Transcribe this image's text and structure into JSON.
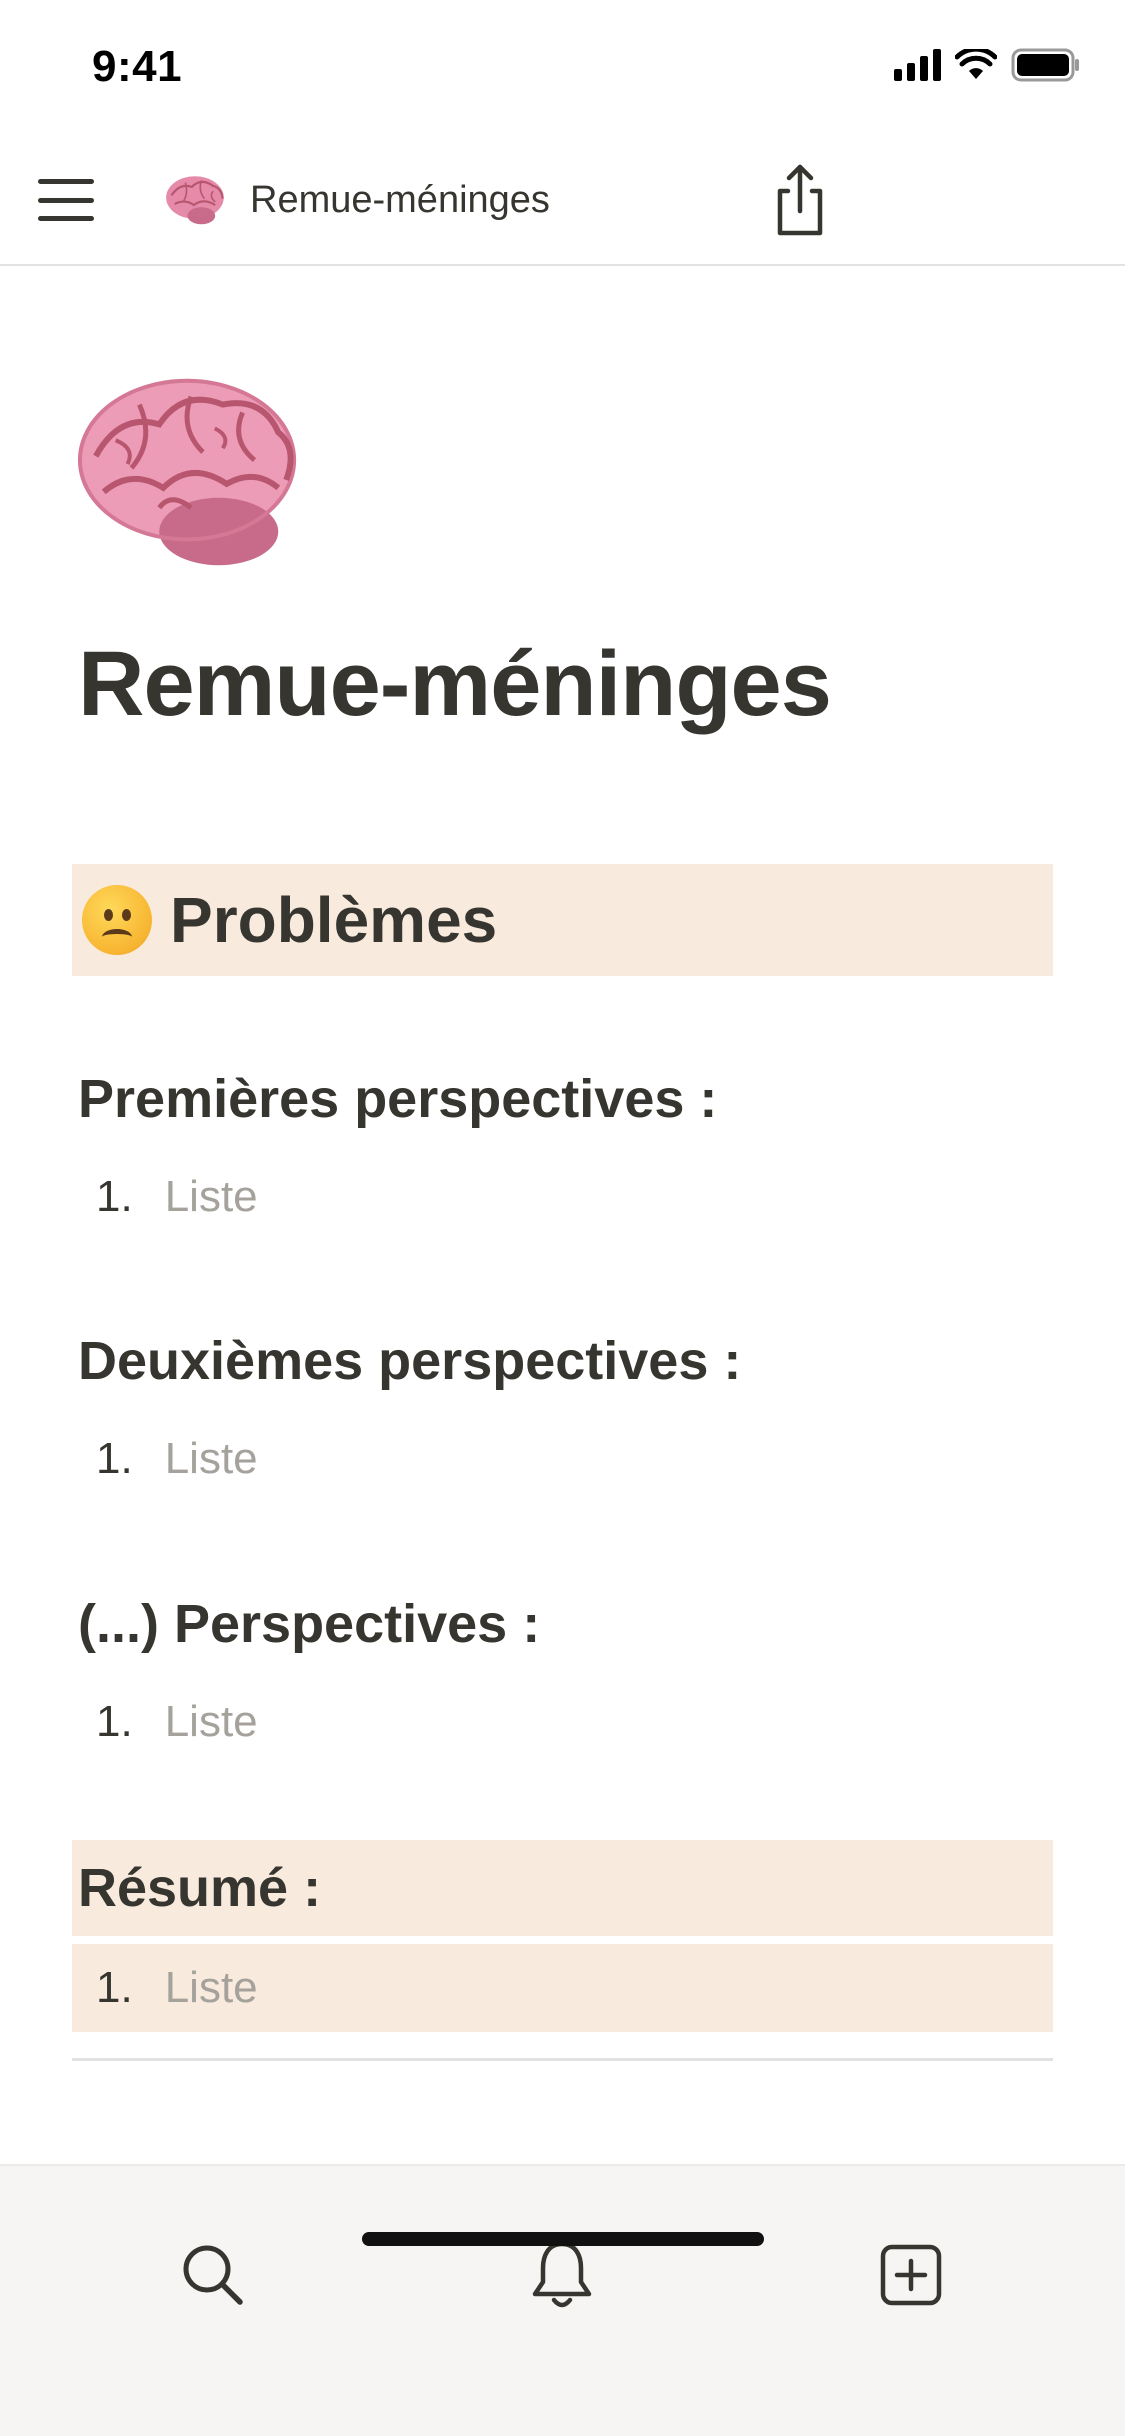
{
  "status_bar": {
    "time": "9:41"
  },
  "top_nav": {
    "page_title": "Remue-méninges"
  },
  "page": {
    "title": "Remue-méninges",
    "callout_heading": "Problèmes",
    "sections": [
      {
        "heading": "Premières perspectives :",
        "items": [
          {
            "number": "1.",
            "placeholder": "Liste"
          }
        ]
      },
      {
        "heading": "Deuxièmes perspectives :",
        "items": [
          {
            "number": "1.",
            "placeholder": "Liste"
          }
        ]
      },
      {
        "heading": "(...) Perspectives :",
        "items": [
          {
            "number": "1.",
            "placeholder": "Liste"
          }
        ]
      }
    ],
    "summary": {
      "heading": "Résumé :",
      "items": [
        {
          "number": "1.",
          "placeholder": "Liste"
        }
      ]
    }
  },
  "colors": {
    "text": "#37352f",
    "placeholder": "#a5a29c",
    "callout_bg": "#f8ebde",
    "bottom_bar_bg": "#f6f5f4"
  },
  "bottom_bar": {
    "icons": [
      "search-icon",
      "bell-icon",
      "new-page-icon"
    ]
  }
}
